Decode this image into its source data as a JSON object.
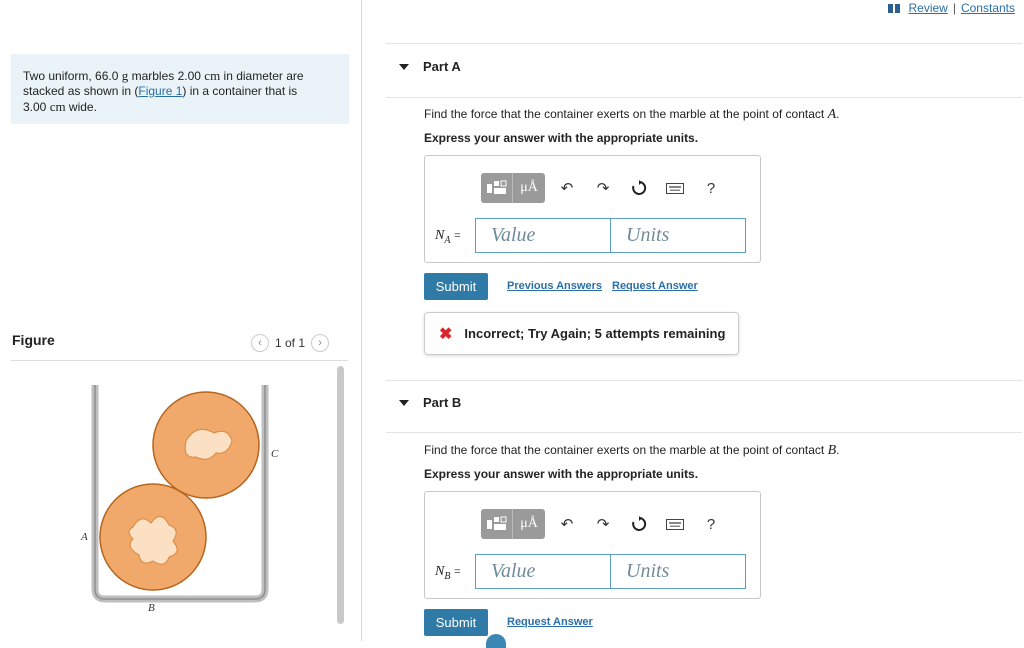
{
  "header": {
    "review": "Review",
    "separator": "|",
    "constants": "Constants"
  },
  "problem": {
    "text_before_mass": "Two uniform, ",
    "mass": "66.0",
    "mass_unit": "g",
    "text_marbles": " marbles ",
    "diameter": "2.00",
    "diameter_unit": "cm",
    "text_diam": " in diameter are stacked as shown in (",
    "figure_link": "Figure 1",
    "text_container": ") in a container that is ",
    "width": "3.00",
    "width_unit": "cm",
    "text_end": " wide."
  },
  "figure": {
    "title": "Figure",
    "pager": "1 of 1",
    "label_a": "A",
    "label_b": "B",
    "label_c": "C"
  },
  "part_a": {
    "title": "Part A",
    "question_prefix": "Find the force that the container exerts on the marble at the point of contact ",
    "point": "A",
    "instruction": "Express your answer with the appropriate units.",
    "var_main": "N",
    "var_sub": "A",
    "equals": "=",
    "value_placeholder": "Value",
    "units_placeholder": "Units",
    "submit": "Submit",
    "previous_answers": "Previous Answers",
    "request_answer": "Request Answer",
    "feedback": "Incorrect; Try Again; 5 attempts remaining"
  },
  "part_b": {
    "title": "Part B",
    "question_prefix": "Find the force that the container exerts on the marble at the point of contact ",
    "point": "B",
    "instruction": "Express your answer with the appropriate units.",
    "var_main": "N",
    "var_sub": "B",
    "equals": "=",
    "value_placeholder": "Value",
    "units_placeholder": "Units",
    "submit": "Submit",
    "request_answer": "Request Answer"
  },
  "toolbar": {
    "mu_label": "μÅ",
    "help": "?"
  },
  "colors": {
    "accent": "#2f7aa7",
    "marble": "#f0a96a",
    "error": "#d9262c"
  }
}
